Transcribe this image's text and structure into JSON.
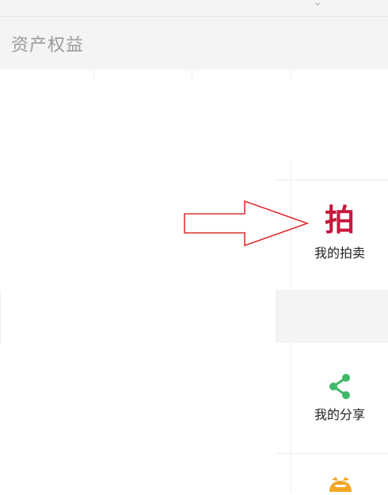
{
  "section": {
    "title": "资产权益"
  },
  "tiles": [
    {
      "icon": "auction-icon",
      "icon_glyph": "拍",
      "icon_color": "#c8173b",
      "label": "我的拍卖"
    },
    {
      "icon": "share-icon",
      "icon_color": "#3fb968",
      "label": "我的分享"
    },
    {
      "icon": "partial-orange-icon",
      "icon_color": "#f5a623"
    }
  ],
  "annotation": {
    "arrow_color": "#e03030"
  }
}
